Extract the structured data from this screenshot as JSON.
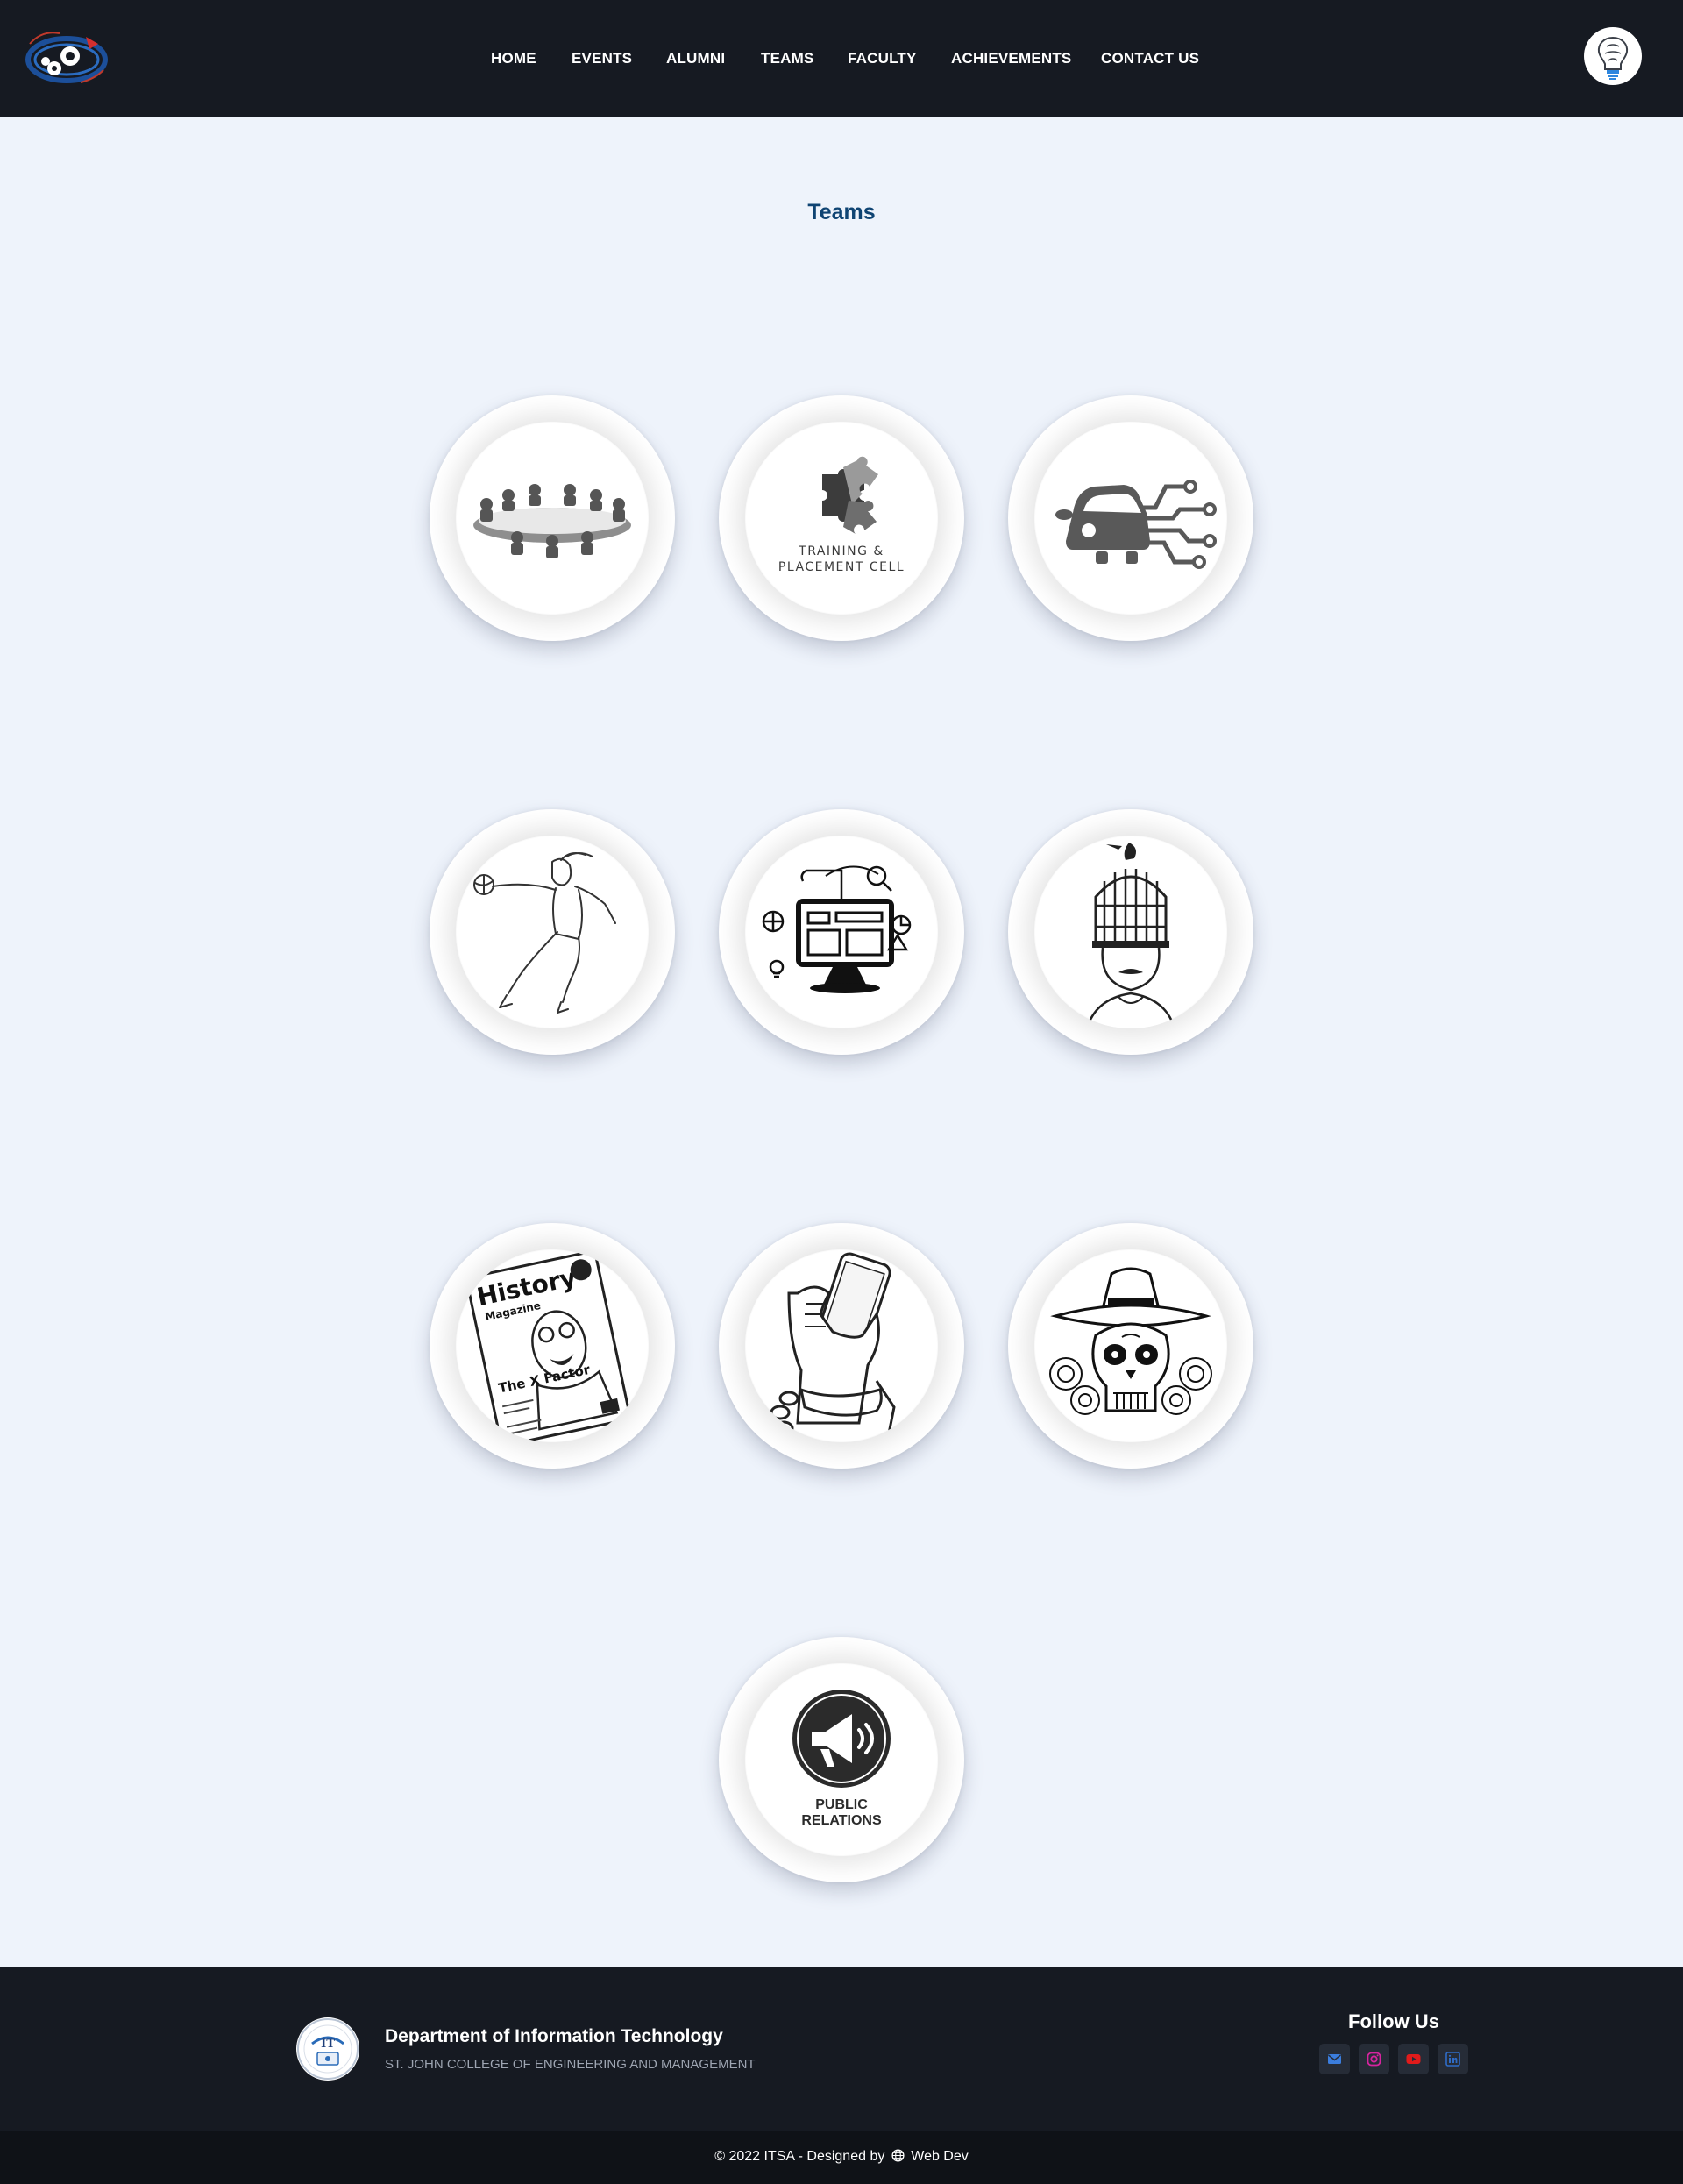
{
  "navbar": {
    "links": [
      {
        "label": "HOME"
      },
      {
        "label": "EVENTS"
      },
      {
        "label": "ALUMNI"
      },
      {
        "label": "TEAMS"
      },
      {
        "label": "FACULTY"
      },
      {
        "label": "ACHIEVEMENTS"
      },
      {
        "label": "CONTACT US"
      }
    ],
    "logo_icon": "gears-logo-icon",
    "avatar_icon": "brain-lightbulb-icon"
  },
  "main": {
    "title": "Teams",
    "teams": [
      {
        "icon": "round-table-meeting-icon"
      },
      {
        "icon": "puzzle-training-icon",
        "caption_line1": "TRAINING &",
        "caption_line2": "PLACEMENT CELL"
      },
      {
        "icon": "car-circuit-icon"
      },
      {
        "icon": "basketball-player-icon"
      },
      {
        "icon": "monitor-analytics-icon"
      },
      {
        "icon": "birdcage-head-icon"
      },
      {
        "icon": "history-magazine-icon",
        "magazine_title": "History",
        "magazine_sub": "Magazine",
        "magazine_headline": "The X Factor"
      },
      {
        "icon": "chained-phone-hand-icon"
      },
      {
        "icon": "sombrero-skull-icon"
      },
      {
        "icon": "megaphone-icon",
        "caption_line1": "PUBLIC",
        "caption_line2": "RELATIONS"
      }
    ]
  },
  "footer": {
    "dept_title": "Department of Information Technology",
    "college_name": "ST. JOHN COLLEGE OF ENGINEERING AND MANAGEMENT",
    "follow_title": "Follow Us",
    "social": [
      {
        "icon": "email-icon",
        "color": "#3b7ddd"
      },
      {
        "icon": "instagram-icon",
        "color": "#d6249f"
      },
      {
        "icon": "youtube-icon",
        "color": "#e11b1b"
      },
      {
        "icon": "linkedin-icon",
        "color": "#2f6cc7"
      }
    ],
    "copyright_pre": "© 2022 ITSA - Designed by",
    "copyright_post": "Web Dev"
  },
  "colors": {
    "nav_bg": "#161a22",
    "page_bg": "#eef3fb",
    "title": "#0f4473"
  }
}
